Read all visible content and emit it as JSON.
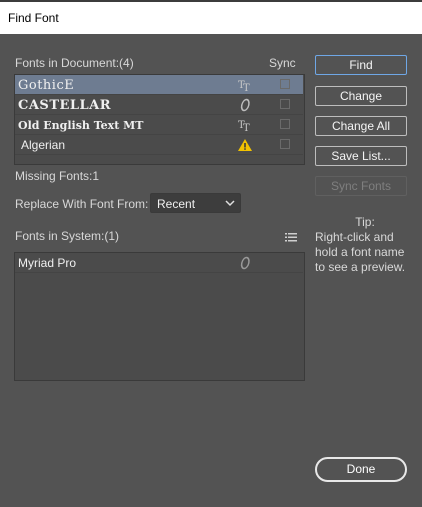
{
  "window": {
    "title": "Find Font"
  },
  "doc_fonts": {
    "header": "Fonts in Document:(4)",
    "sync_header": "Sync",
    "rows": [
      {
        "name": "GothicE",
        "type_icon": "truetype-icon",
        "type_glyph": "TT",
        "selected": true
      },
      {
        "name": "CASTELLAR",
        "type_icon": "opentype-icon",
        "type_glyph": "O",
        "selected": false
      },
      {
        "name": "Old English Text MT",
        "type_icon": "truetype-icon",
        "type_glyph": "TT",
        "selected": false
      },
      {
        "name": "Algerian",
        "type_icon": "warning-icon",
        "type_glyph": "!",
        "selected": false
      }
    ]
  },
  "missing": {
    "label": "Missing Fonts:1"
  },
  "replace": {
    "label": "Replace With Font From:",
    "selected": "Recent"
  },
  "system_fonts": {
    "header": "Fonts in System:(1)",
    "menu_icon": "list-menu-icon",
    "rows": [
      {
        "name": "Myriad Pro",
        "type_icon": "opentype-icon",
        "type_glyph": "O"
      }
    ]
  },
  "buttons": {
    "find": "Find",
    "change": "Change",
    "change_all": "Change All",
    "save_list": "Save List...",
    "sync_fonts": "Sync Fonts",
    "done": "Done"
  },
  "tip": {
    "title": "Tip:",
    "text": "Right-click and hold a font name to see a preview."
  },
  "colors": {
    "background": "#535353",
    "selection": "#6e7c91",
    "primary_border": "#6fa7e6",
    "warning": "#f2c200"
  }
}
